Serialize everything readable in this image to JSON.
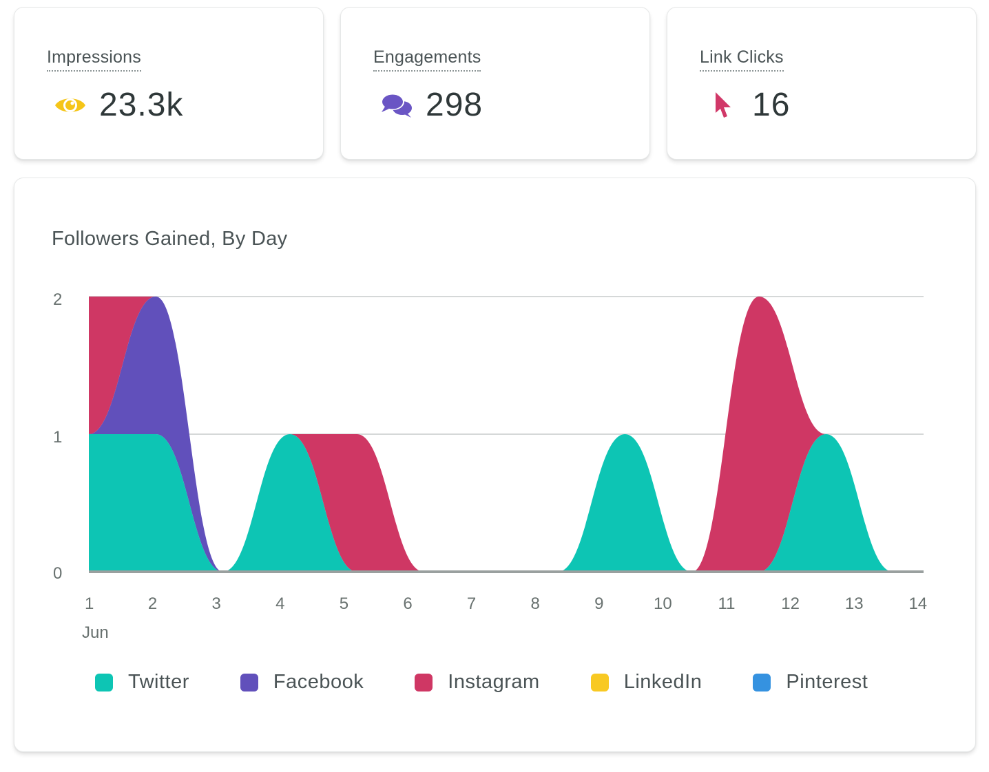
{
  "stats": [
    {
      "label": "Impressions",
      "value": "23.3k",
      "icon": "eye-icon",
      "color": "#f5c518"
    },
    {
      "label": "Engagements",
      "value": "298",
      "icon": "chat-bubbles-icon",
      "color": "#6a55c4"
    },
    {
      "label": "Link Clicks",
      "value": "16",
      "icon": "cursor-arrow-icon",
      "color": "#d13868"
    }
  ],
  "chart_data": {
    "type": "area",
    "stacked": true,
    "title": "Followers Gained, By Day",
    "xlabel": "",
    "ylabel": "",
    "x": [
      1,
      2,
      3,
      4,
      5,
      6,
      7,
      8,
      9,
      10,
      11,
      12,
      13
    ],
    "x_tick_labels": [
      "1",
      "2",
      "3",
      "4",
      "5",
      "6",
      "7",
      "8",
      "9",
      "10",
      "11",
      "12",
      "13",
      "14"
    ],
    "x_sublabel": "Jun",
    "y_ticks": [
      "0",
      "1",
      "2"
    ],
    "ylim": [
      0,
      2
    ],
    "grid": true,
    "legend_position": "bottom",
    "series": [
      {
        "name": "Twitter",
        "color": "#0dc5b4",
        "values": [
          1,
          1,
          0,
          1,
          0,
          0,
          0,
          0,
          1,
          0,
          0,
          1,
          0
        ]
      },
      {
        "name": "Facebook",
        "color": "#6150bb",
        "values": [
          0,
          1,
          0,
          0,
          0,
          0,
          0,
          0,
          0,
          0,
          0,
          0,
          0
        ]
      },
      {
        "name": "Instagram",
        "color": "#cf3764",
        "values": [
          1,
          0,
          0,
          0,
          1,
          0,
          0,
          0,
          0,
          0,
          2,
          0,
          0
        ]
      },
      {
        "name": "LinkedIn",
        "color": "#f8c923",
        "values": [
          0,
          0,
          0,
          0,
          0,
          0,
          0,
          0,
          0,
          0,
          0,
          0,
          0
        ]
      },
      {
        "name": "Pinterest",
        "color": "#3592e0",
        "values": [
          0,
          0,
          0,
          0,
          0,
          0,
          0,
          0,
          0,
          0,
          0,
          0,
          0
        ]
      }
    ]
  }
}
